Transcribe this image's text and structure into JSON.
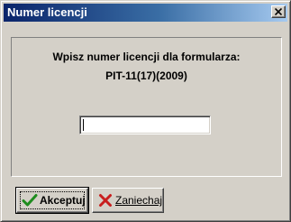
{
  "window": {
    "title": "Numer licencji",
    "close_symbol": "×"
  },
  "dialog": {
    "prompt": "Wpisz numer licencji dla formularza:",
    "form_name": "PIT-11(17)(2009)",
    "license_value": ""
  },
  "buttons": {
    "ok_label": "Akceptuj",
    "ok_icon": "check-icon",
    "cancel_label": "Zaniechaj",
    "cancel_icon": "x-icon"
  },
  "colors": {
    "title_gradient_start": "#0a246a",
    "title_gradient_end": "#a6caf0",
    "face": "#d4d0c8",
    "check": "#1e8c1e",
    "cross": "#c81e1e"
  }
}
